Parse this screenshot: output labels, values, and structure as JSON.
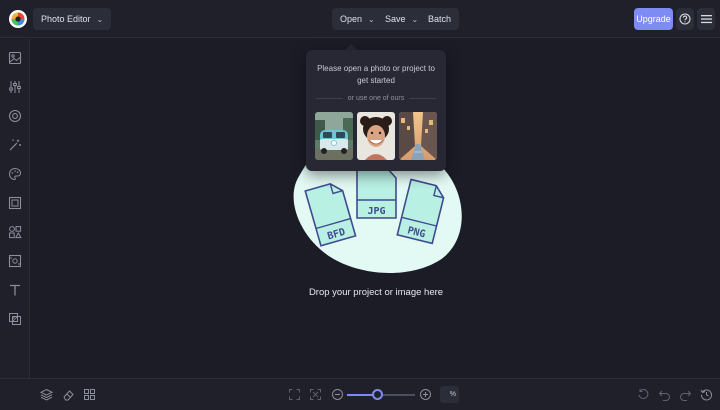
{
  "header": {
    "app_menu_label": "Photo Editor",
    "open_label": "Open",
    "save_label": "Save",
    "batch_label": "Batch",
    "upgrade_label": "Upgrade"
  },
  "popover": {
    "message": "Please open a photo or project to get started",
    "divider_text": "or use one of ours",
    "samples": [
      "vintage-van-photo",
      "portrait-photo",
      "canal-street-photo"
    ]
  },
  "dropzone": {
    "file_types": [
      "BFD",
      "JPG",
      "PNG"
    ],
    "message": "Drop your project or image here"
  },
  "sidebar": {
    "tools": [
      "image-icon",
      "sliders-icon",
      "target-icon",
      "magic-icon",
      "palette-icon",
      "frame-icon",
      "shapes-icon",
      "texture-icon",
      "text-icon",
      "layers-icon"
    ]
  },
  "footer": {
    "zoom_unit": "%",
    "zoom_level_fraction": 0.45
  },
  "colors": {
    "background": "#1b1c26",
    "panel": "#1f2029",
    "accent": "#7d8cf3",
    "blob": "#e3f9f4",
    "file_fill": "#b9f0e4",
    "file_stroke": "#3f4b8f"
  }
}
